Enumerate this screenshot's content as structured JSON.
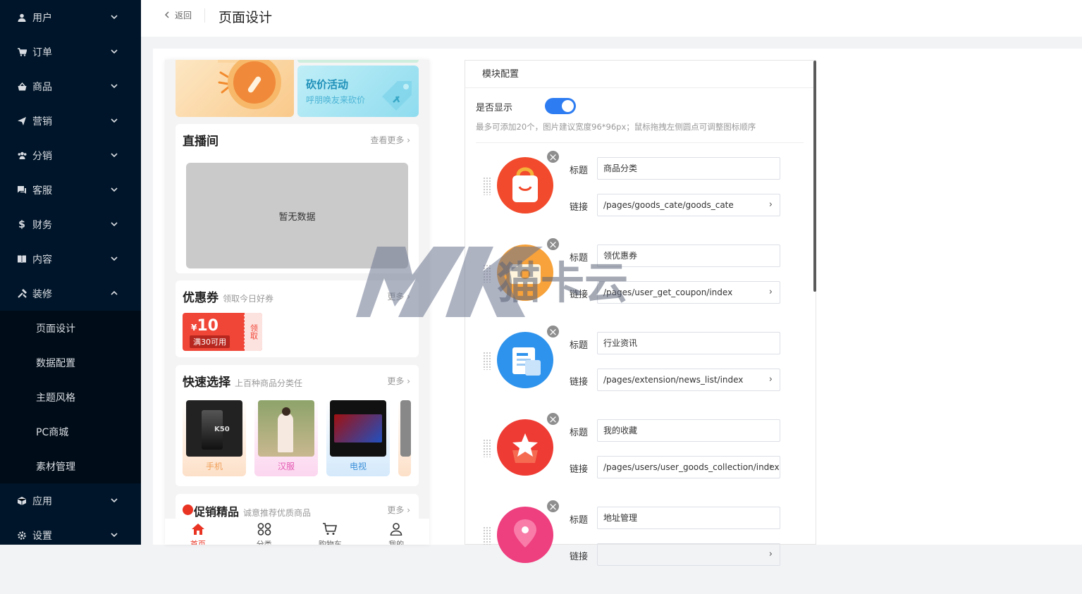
{
  "sidebar": {
    "items": [
      {
        "label": "用户",
        "icon": "user-icon"
      },
      {
        "label": "订单",
        "icon": "cart-icon"
      },
      {
        "label": "商品",
        "icon": "basket-icon"
      },
      {
        "label": "营销",
        "icon": "send-icon"
      },
      {
        "label": "分销",
        "icon": "group-icon"
      },
      {
        "label": "客服",
        "icon": "chat-icon"
      },
      {
        "label": "财务",
        "icon": "dollar-icon"
      },
      {
        "label": "内容",
        "icon": "book-icon"
      },
      {
        "label": "装修",
        "icon": "tools-icon"
      }
    ],
    "sub_items": [
      "页面设计",
      "数据配置",
      "主题风格",
      "PC商城",
      "素材管理"
    ],
    "after_items": [
      {
        "label": "应用",
        "icon": "cube-icon"
      },
      {
        "label": "设置",
        "icon": "gear-icon"
      }
    ]
  },
  "header": {
    "back_label": "返回",
    "title": "页面设计"
  },
  "phone": {
    "banner_right_title": "砍价活动",
    "banner_right_sub": "呼朋唤友来砍价",
    "live": {
      "title": "直播间",
      "more": "查看更多",
      "empty": "暂无数据"
    },
    "coupon": {
      "title": "优惠券",
      "sub": "领取今日好券",
      "more": "更多",
      "currency": "¥",
      "amount": "10",
      "condition": "满30可用",
      "get": "领取"
    },
    "quick": {
      "title": "快速选择",
      "sub": "上百种商品分类任",
      "more": "更多",
      "products": [
        {
          "label": "手机",
          "color": "#f0a05a"
        },
        {
          "label": "汉服",
          "color": "#e35bb3"
        },
        {
          "label": "电视",
          "color": "#3a8fd8"
        }
      ]
    },
    "promo": {
      "title": "促销精品",
      "sub": "诚意推荐优质商品",
      "more": "更多"
    },
    "tabbar": [
      "首页",
      "分类",
      "购物车",
      "我的"
    ]
  },
  "panel": {
    "title": "模块配置",
    "show_label": "是否显示",
    "show_on": true,
    "hint": "最多可添加20个，图片建议宽度96*96px；鼠标拖拽左侧圆点可调整图标顺序",
    "title_key": "标题",
    "link_key": "链接",
    "items": [
      {
        "title": "商品分类",
        "link": "/pages/goods_cate/goods_cate",
        "color": "#f24a2c"
      },
      {
        "title": "领优惠券",
        "link": "/pages/user_get_coupon/index",
        "color": "#f7a23a"
      },
      {
        "title": "行业资讯",
        "link": "/pages/extension/news_list/index",
        "color": "#2e93ec"
      },
      {
        "title": "我的收藏",
        "link": "/pages/users/user_goods_collection/index",
        "color": "#ee3b33"
      },
      {
        "title": "地址管理",
        "link": "",
        "color": "#ee3f7e"
      }
    ]
  },
  "watermark": {
    "text": "猫卡云"
  }
}
